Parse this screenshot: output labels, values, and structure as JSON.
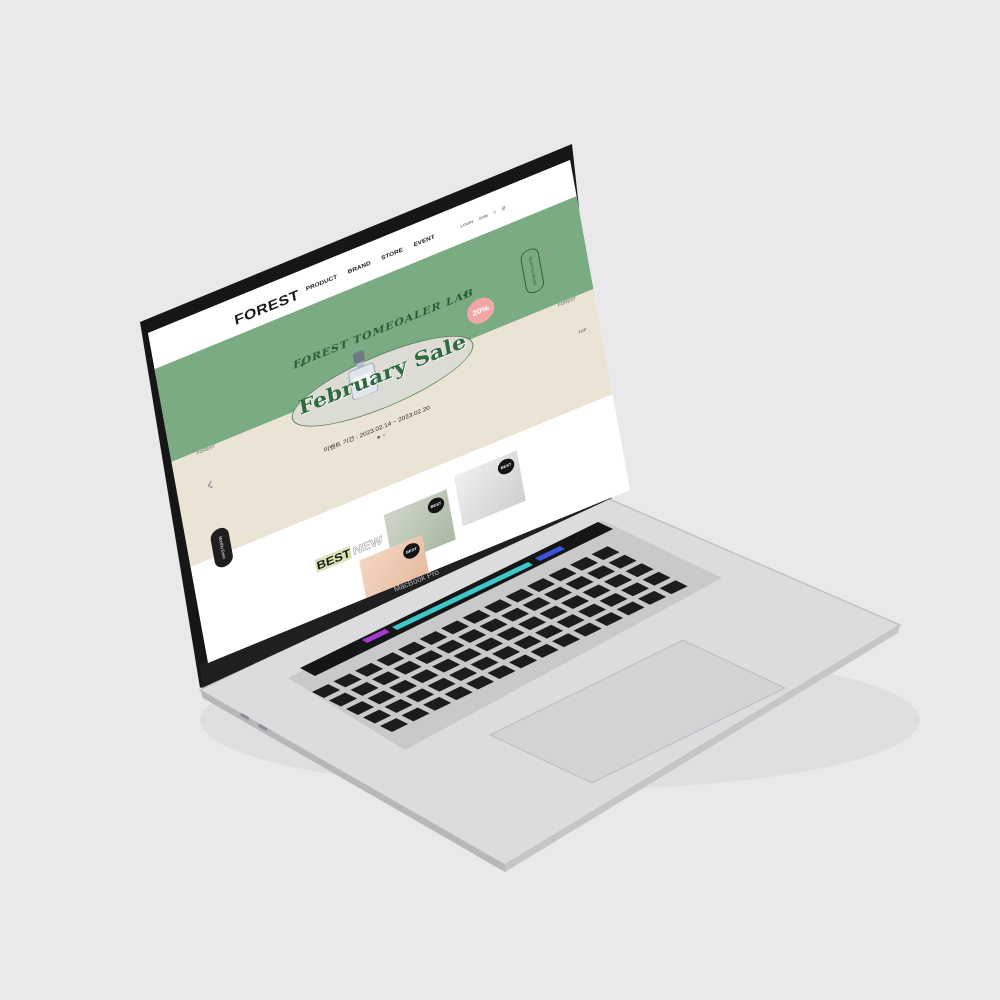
{
  "site": {
    "logo": "FOREST",
    "nav": [
      "PRODUCT",
      "BRAND",
      "STORE",
      "EVENT"
    ],
    "util": [
      "LOGIN",
      "JOIN"
    ],
    "selected_brand_label": "SELECTED BRAND"
  },
  "hero": {
    "arch_title": "FOREST TOMEOALER LAB",
    "sale_title": "February Sale",
    "badge": "20%",
    "period": "이벤트 기간 : 2023.02.14 ~ 2023.02.20",
    "side_left": "FOREST",
    "side_right": "FOREST",
    "monthly_label": "Monthly Event",
    "top_label": "TOP"
  },
  "products": {
    "best_label": "BEST",
    "new_label": "NEW",
    "card_badge": "BEST"
  },
  "device": {
    "model_label": "MacBook Pro"
  },
  "colors": {
    "hero_green": "#7aab82",
    "hero_beige": "#ebe4d5",
    "sale_green": "#2f6b3e",
    "badge_pink": "#f3a6a8"
  }
}
